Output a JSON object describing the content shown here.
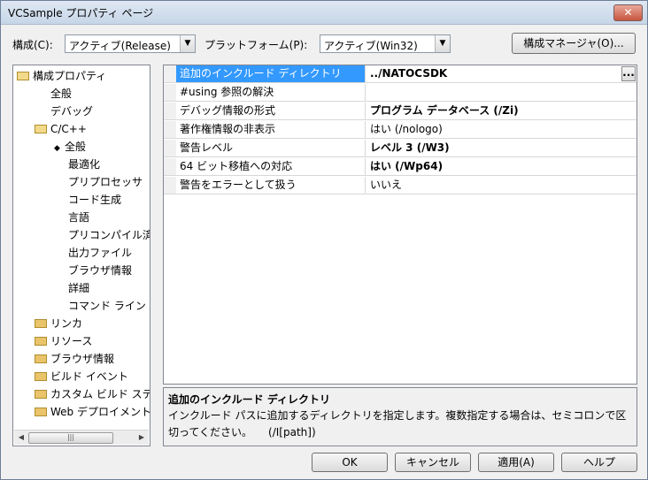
{
  "window": {
    "title": "VCSample プロパティ ページ",
    "close_glyph": "✕"
  },
  "toolbar": {
    "config_label": "構成(C):",
    "config_value": "アクティブ(Release)",
    "platform_label": "プラットフォーム(P):",
    "platform_value": "アクティブ(Win32)",
    "config_manager_label": "構成マネージャ(O)..."
  },
  "tree": {
    "root": "構成プロパティ",
    "items": [
      {
        "label": "全般",
        "icon": "none"
      },
      {
        "label": "デバッグ",
        "icon": "none"
      },
      {
        "label": "C/C++",
        "icon": "folder-open-icon"
      },
      {
        "label": "全般",
        "icon": "arrow-icon",
        "selected": true
      },
      {
        "label": "最適化",
        "icon": "none"
      },
      {
        "label": "プリプロセッサ",
        "icon": "none"
      },
      {
        "label": "コード生成",
        "icon": "none"
      },
      {
        "label": "言語",
        "icon": "none"
      },
      {
        "label": "プリコンパイル済",
        "icon": "none"
      },
      {
        "label": "出力ファイル",
        "icon": "none"
      },
      {
        "label": "ブラウザ情報",
        "icon": "none"
      },
      {
        "label": "詳細",
        "icon": "none"
      },
      {
        "label": "コマンド ライン",
        "icon": "none"
      },
      {
        "label": "リンカ",
        "icon": "folder-icon"
      },
      {
        "label": "リソース",
        "icon": "folder-icon"
      },
      {
        "label": "ブラウザ情報",
        "icon": "folder-icon"
      },
      {
        "label": "ビルド イベント",
        "icon": "folder-icon"
      },
      {
        "label": "カスタム ビルド ステ",
        "icon": "folder-icon"
      },
      {
        "label": "Web デプロイメント",
        "icon": "folder-icon"
      }
    ],
    "scroll_thumb_glyph": "|||"
  },
  "properties": [
    {
      "name": "追加のインクルード ディレクトリ",
      "value": "../NATOCSDK",
      "bold": true,
      "selected": true,
      "has_button": true
    },
    {
      "name": "#using 参照の解決",
      "value": "",
      "bold": false
    },
    {
      "name": "デバッグ情報の形式",
      "value": "プログラム データベース (/Zi)",
      "bold": true
    },
    {
      "name": "著作権情報の非表示",
      "value": "はい (/nologo)",
      "bold": false
    },
    {
      "name": "警告レベル",
      "value": "レベル 3 (/W3)",
      "bold": true
    },
    {
      "name": "64 ビット移植への対応",
      "value": "はい (/Wp64)",
      "bold": true
    },
    {
      "name": "警告をエラーとして扱う",
      "value": "いいえ",
      "bold": false
    }
  ],
  "ellipsis_label": "...",
  "description": {
    "title": "追加のインクルード ディレクトリ",
    "text": "インクルード パスに追加するディレクトリを指定します。複数指定する場合は、セミコロンで区切ってください。　　(/I[path])"
  },
  "buttons": {
    "ok": "OK",
    "cancel": "キャンセル",
    "apply": "適用(A)",
    "help": "ヘルプ"
  }
}
